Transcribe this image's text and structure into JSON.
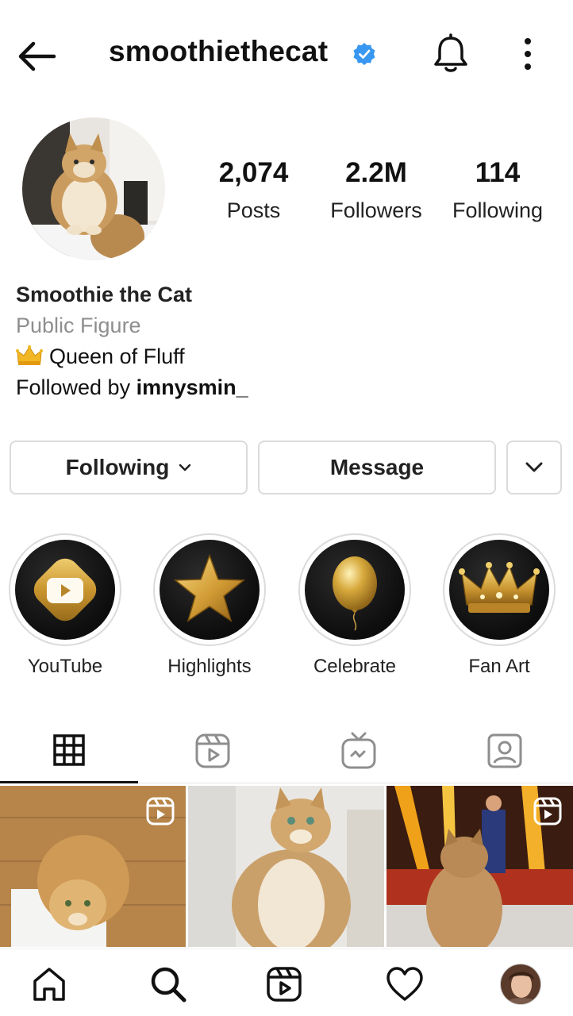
{
  "header": {
    "username": "smoothiethecat",
    "back_icon": "arrow-left-icon",
    "verified_icon": "verified-badge-icon",
    "notifications_icon": "bell-icon",
    "more_icon": "more-vertical-icon",
    "verified_color": "#3897f0"
  },
  "profile": {
    "stats": [
      {
        "value": "2,074",
        "label": "Posts"
      },
      {
        "value": "2.2M",
        "label": "Followers"
      },
      {
        "value": "114",
        "label": "Following"
      }
    ],
    "name": "Smoothie the Cat",
    "category": "Public Figure",
    "bio": "Queen of Fluff",
    "bio_emoji": "crown-emoji",
    "followed_by_prefix": "Followed by",
    "followed_by_user": "imnysmin_"
  },
  "actions": {
    "following_label": "Following",
    "message_label": "Message",
    "dropdown_icon": "chevron-down-icon"
  },
  "highlights": [
    {
      "label": "YouTube",
      "icon": "youtube-icon"
    },
    {
      "label": "Highlights",
      "icon": "star-icon"
    },
    {
      "label": "Celebrate",
      "icon": "balloon-icon"
    },
    {
      "label": "Fan Art",
      "icon": "crown-icon"
    }
  ],
  "tabs": [
    {
      "icon": "grid-icon",
      "active": true
    },
    {
      "icon": "reels-icon",
      "active": false
    },
    {
      "icon": "igtv-icon",
      "active": false
    },
    {
      "icon": "tagged-icon",
      "active": false
    }
  ],
  "posts": [
    {
      "type": "reel",
      "icon": "reel-badge-icon"
    },
    {
      "type": "photo"
    },
    {
      "type": "reel",
      "icon": "reel-badge-icon"
    }
  ],
  "bottom_nav": [
    "home-icon",
    "search-icon",
    "reels-icon",
    "heart-icon",
    "profile-avatar"
  ],
  "colors": {
    "accent_gold": "#d4a72c",
    "border": "#dbdbdb",
    "secondary_text": "#8e8e8e"
  }
}
